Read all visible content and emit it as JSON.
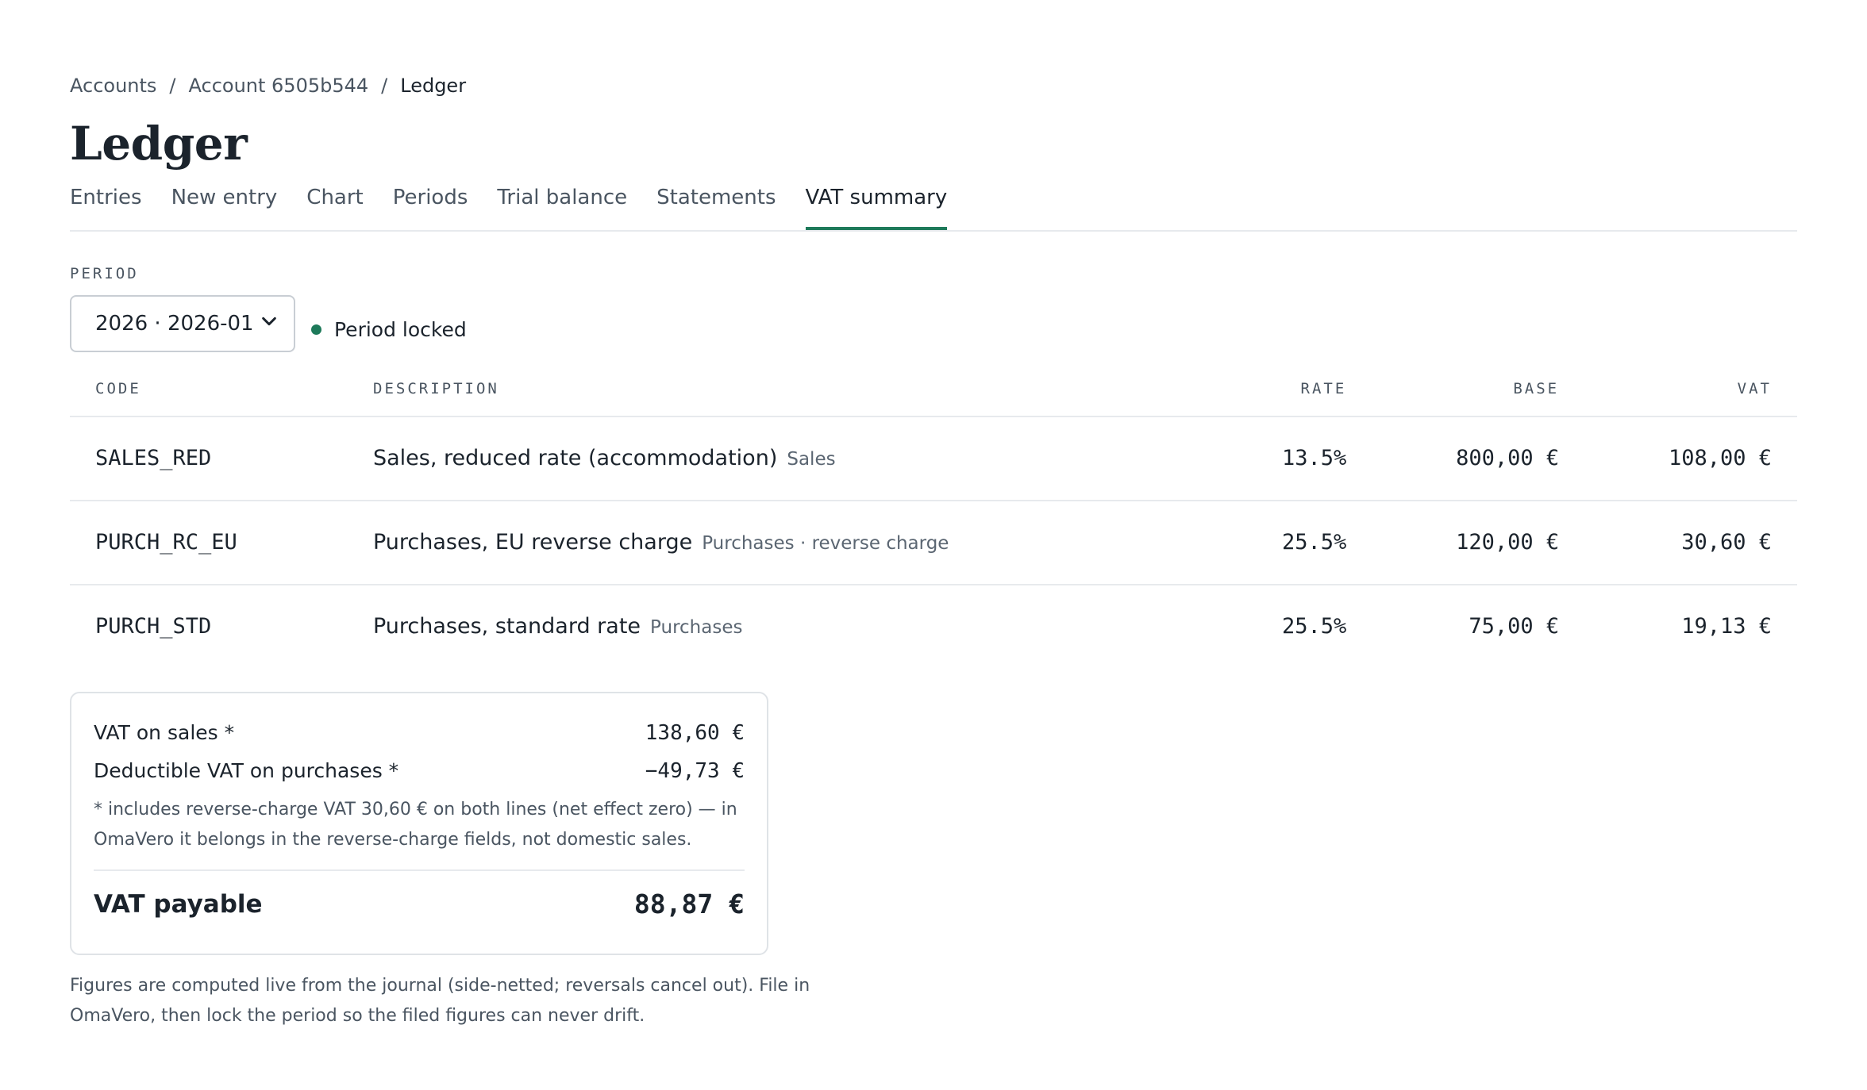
{
  "breadcrumb": {
    "items": [
      "Accounts",
      "Account 6505b544"
    ],
    "current": "Ledger",
    "separator": "/"
  },
  "page": {
    "title": "Ledger"
  },
  "tabs": [
    {
      "label": "Entries"
    },
    {
      "label": "New entry"
    },
    {
      "label": "Chart"
    },
    {
      "label": "Periods"
    },
    {
      "label": "Trial balance"
    },
    {
      "label": "Statements"
    },
    {
      "label": "VAT summary",
      "active": true
    }
  ],
  "period": {
    "label": "PERIOD",
    "selected": "2026 · 2026-01",
    "status": "Period locked",
    "status_color": "#1e7a5a"
  },
  "table": {
    "headers": {
      "code": "CODE",
      "description": "DESCRIPTION",
      "rate": "RATE",
      "base": "BASE",
      "vat": "VAT"
    },
    "rows": [
      {
        "code": "SALES_RED",
        "description": "Sales, reduced rate (accommodation)",
        "tag": "Sales",
        "rate": "13.5%",
        "base": "800,00 €",
        "vat": "108,00 €"
      },
      {
        "code": "PURCH_RC_EU",
        "description": "Purchases, EU reverse charge",
        "tag": "Purchases · reverse charge",
        "rate": "25.5%",
        "base": "120,00 €",
        "vat": "30,60 €"
      },
      {
        "code": "PURCH_STD",
        "description": "Purchases, standard rate",
        "tag": "Purchases",
        "rate": "25.5%",
        "base": "75,00 €",
        "vat": "19,13 €"
      }
    ]
  },
  "summary": {
    "sales_label": "VAT on sales *",
    "sales_value": "138,60 €",
    "deductible_label": "Deductible VAT on purchases *",
    "deductible_value": "−49,73 €",
    "note": "* includes reverse-charge VAT 30,60 € on both lines (net effect zero) — in OmaVero it belongs in the reverse-charge fields, not domestic sales.",
    "payable_label": "VAT payable",
    "payable_value": "88,87 €"
  },
  "footnote": "Figures are computed live from the journal (side-netted; reversals cancel out). File in OmaVero, then lock the period so the filed figures can never drift.",
  "colors": {
    "accent": "#1e7a5a",
    "text": "#1b232c",
    "muted": "#4a5561",
    "border": "#e7eaed"
  },
  "icons": {
    "select": "chevron-down-icon",
    "status": "status-dot-icon"
  }
}
